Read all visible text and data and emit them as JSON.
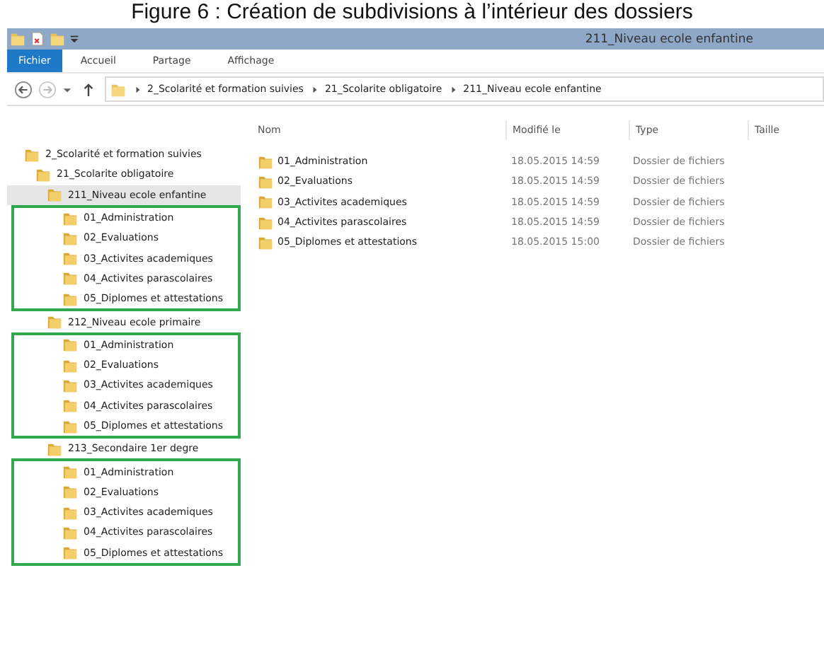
{
  "caption": "Figure 6 : Création de subdivisions à l’intérieur des dossiers",
  "window": {
    "title": "211_Niveau ecole enfantine"
  },
  "ribbon_tabs": [
    {
      "label": "Fichier",
      "selected": true
    },
    {
      "label": "Accueil",
      "selected": false
    },
    {
      "label": "Partage",
      "selected": false
    },
    {
      "label": "Affichage",
      "selected": false
    }
  ],
  "address_bar": {
    "crumbs": [
      "2_Scolarité et formation suivies",
      "21_Scolarite obligatoire",
      "211_Niveau ecole enfantine"
    ]
  },
  "tree": [
    {
      "label": "2_Scolarité et formation suivies",
      "selected": false,
      "outlined": false,
      "children": [
        {
          "label": "21_Scolarite obligatoire",
          "selected": false,
          "outlined": false,
          "children": [
            {
              "label": "211_Niveau ecole enfantine",
              "selected": true,
              "outlined": true,
              "children": [
                {
                  "label": "01_Administration",
                  "selected": false
                },
                {
                  "label": "02_Evaluations",
                  "selected": false
                },
                {
                  "label": "03_Activites academiques",
                  "selected": false
                },
                {
                  "label": "04_Activites parascolaires",
                  "selected": false
                },
                {
                  "label": "05_Diplomes et attestations",
                  "selected": false
                }
              ]
            },
            {
              "label": "212_Niveau ecole primaire",
              "selected": false,
              "outlined": true,
              "children": [
                {
                  "label": "01_Administration",
                  "selected": false
                },
                {
                  "label": "02_Evaluations",
                  "selected": false
                },
                {
                  "label": "03_Activites academiques",
                  "selected": false
                },
                {
                  "label": "04_Activites parascolaires",
                  "selected": false
                },
                {
                  "label": "05_Diplomes et attestations",
                  "selected": false
                }
              ]
            },
            {
              "label": "213_Secondaire 1er degre",
              "selected": false,
              "outlined": true,
              "children": [
                {
                  "label": "01_Administration",
                  "selected": false
                },
                {
                  "label": "02_Evaluations",
                  "selected": false
                },
                {
                  "label": "03_Activites academiques",
                  "selected": false
                },
                {
                  "label": "04_Activites parascolaires",
                  "selected": false
                },
                {
                  "label": "05_Diplomes et attestations",
                  "selected": false
                }
              ]
            }
          ]
        }
      ]
    }
  ],
  "file_list": {
    "columns": [
      "Nom",
      "Modifié le",
      "Type",
      "Taille"
    ],
    "rows": [
      {
        "name": "01_Administration",
        "modified": "18.05.2015 14:59",
        "type": "Dossier de fichiers"
      },
      {
        "name": "02_Evaluations",
        "modified": "18.05.2015 14:59",
        "type": "Dossier de fichiers"
      },
      {
        "name": "03_Activites academiques",
        "modified": "18.05.2015 14:59",
        "type": "Dossier de fichiers"
      },
      {
        "name": "04_Activites parascolaires",
        "modified": "18.05.2015 14:59",
        "type": "Dossier de fichiers"
      },
      {
        "name": "05_Diplomes et attestations",
        "modified": "18.05.2015 15:00",
        "type": "Dossier de fichiers"
      }
    ]
  }
}
